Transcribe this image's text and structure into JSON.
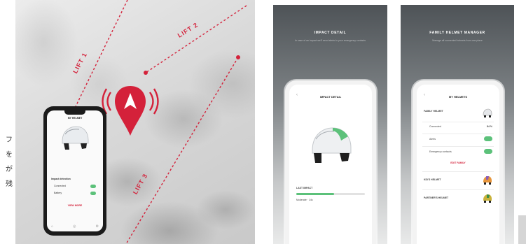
{
  "side_text": [
    "フ",
    "を",
    "が",
    "残"
  ],
  "map": {
    "lift_labels": [
      "LIFT 1",
      "LIFT 2",
      "LIFT 3"
    ],
    "accent_color": "#d4213a",
    "phone": {
      "title": "MY HELMET",
      "rows": [
        "Impact detection",
        "Connected",
        "Battery"
      ],
      "link": "VIEW MORE"
    }
  },
  "panels": [
    {
      "title": "IMPACT DETAIL",
      "subtitle": "In case of an impact we'll send alerts to your emergency contacts",
      "screen_title": "IMPACT DETAIL",
      "rows": [
        "LAST IMPACT",
        "Moderate · 14s"
      ],
      "level": 0.55
    },
    {
      "title": "FAMILY HELMET MANAGER",
      "subtitle": "Manage all connected helmets from one place",
      "screen_title": "MY HELMETS",
      "rows": [
        "FAMILY HELMET",
        "Connected",
        "Alerts",
        "Emergency contacts",
        "EDIT FAMILY",
        "KID'S HELMET",
        "PARTNER'S HELMET"
      ],
      "value": "84 %"
    }
  ]
}
